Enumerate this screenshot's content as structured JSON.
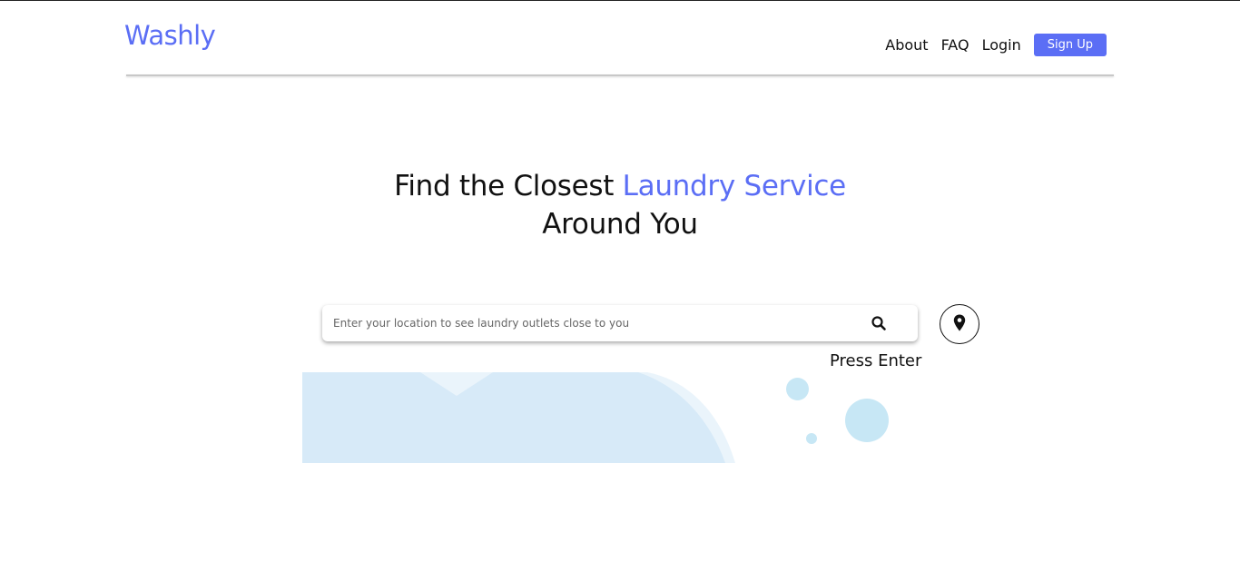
{
  "brand": {
    "name": "Washly",
    "accent_color": "#5b6ef5"
  },
  "nav": {
    "items": [
      {
        "label": "About"
      },
      {
        "label": "FAQ"
      },
      {
        "label": "Login"
      }
    ],
    "signup_label": "Sign Up"
  },
  "hero": {
    "title_start": "Find the Closest ",
    "title_accent": "Laundry Service",
    "title_end": "Around You"
  },
  "search": {
    "placeholder": "Enter your location to see laundry outlets close to you",
    "value": "",
    "hint": "Press Enter",
    "search_icon": "search-icon",
    "location_icon": "map-pin-icon"
  }
}
